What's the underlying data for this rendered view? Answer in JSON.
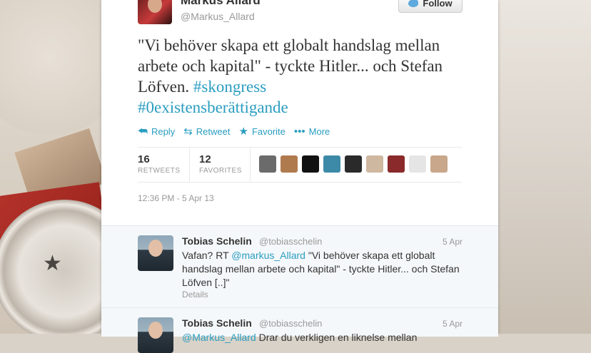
{
  "tweet": {
    "name": "Markus Allard",
    "handle": "@Markus_Allard",
    "follow_label": "Follow",
    "text_main": "\"Vi behöver skapa ett globalt handslag mellan arbete och kapital\" - tyckte Hitler... och Stefan Löfven. ",
    "hashtag1": "#skongress",
    "hashtag2": "#0existensberättigande",
    "actions": {
      "reply": "Reply",
      "retweet": "Retweet",
      "favorite": "Favorite",
      "more": "More"
    },
    "retweets": {
      "count": "16",
      "label": "RETWEETS"
    },
    "favorites": {
      "count": "12",
      "label": "FAVORITES"
    },
    "timestamp": "12:36 PM - 5 Apr 13",
    "face_colors": [
      "#6b6b6b",
      "#b07a4f",
      "#111111",
      "#3d8aa8",
      "#2a2a2a",
      "#cfb8a0",
      "#8a2a2a",
      "#e5e5e5",
      "#c9a78a"
    ]
  },
  "replies": [
    {
      "name": "Tobias Schelin",
      "handle": "@tobiasschelin",
      "date": "5 Apr",
      "text_pre": "Vafan? RT ",
      "mention": "@markus_Allard",
      "text_post": " \"Vi behöver skapa ett globalt handslag mellan arbete och kapital\" - tyckte Hitler... och Stefan Löfven [..]\"",
      "details": "Details"
    },
    {
      "name": "Tobias Schelin",
      "handle": "@tobiasschelin",
      "date": "5 Apr",
      "mention": "@Markus_Allard",
      "text_post": " Drar du verkligen en liknelse mellan"
    }
  ]
}
